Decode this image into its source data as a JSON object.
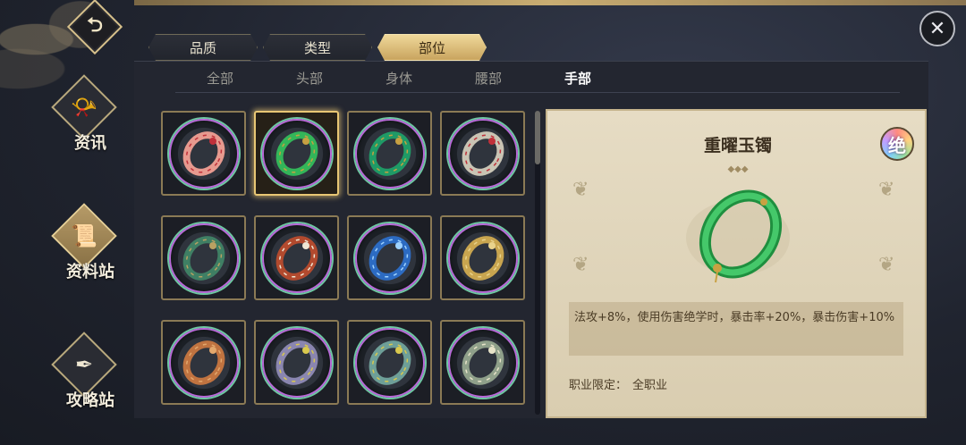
{
  "nav": {
    "back_icon": "back-arrow-icon",
    "close_icon": "close-icon",
    "items": [
      {
        "label": "资讯",
        "icon": "horn-icon",
        "active": false
      },
      {
        "label": "资料站",
        "icon": "scroll-icon",
        "active": true
      },
      {
        "label": "攻略站",
        "icon": "quill-icon",
        "active": false
      }
    ]
  },
  "filter_tabs": [
    {
      "label": "品质",
      "active": false
    },
    {
      "label": "类型",
      "active": false
    },
    {
      "label": "部位",
      "active": true
    }
  ],
  "slot_tabs": [
    {
      "label": "全部",
      "active": false
    },
    {
      "label": "头部",
      "active": false
    },
    {
      "label": "身体",
      "active": false
    },
    {
      "label": "腰部",
      "active": false
    },
    {
      "label": "手部",
      "active": true
    }
  ],
  "items": [
    {
      "icon": "pink-bracelet-icon",
      "color": "#e79a8f",
      "accent": "#c0303a",
      "selected": false
    },
    {
      "icon": "jade-bracelet-icon",
      "color": "#33b559",
      "accent": "#c7a142",
      "selected": true
    },
    {
      "icon": "jade-gem-ring-icon",
      "color": "#1f9a66",
      "accent": "#c7a142",
      "selected": false
    },
    {
      "icon": "silver-ruby-ring-icon",
      "color": "#c9c4b4",
      "accent": "#c0303a",
      "selected": false
    },
    {
      "icon": "green-band-ring-icon",
      "color": "#3f7f64",
      "accent": "#b9a162",
      "selected": false
    },
    {
      "icon": "pearl-bracelet-icon",
      "color": "#b24a2e",
      "accent": "#efe7d4",
      "selected": false
    },
    {
      "icon": "blue-ring-icon",
      "color": "#2c6bc2",
      "accent": "#9fd3ff",
      "selected": false
    },
    {
      "icon": "gold-double-ring-icon",
      "color": "#c8a54f",
      "accent": "#e9d38c",
      "selected": false
    },
    {
      "icon": "copper-double-ring-icon",
      "color": "#c07340",
      "accent": "#e3a86d",
      "selected": false
    },
    {
      "icon": "lavender-scale-ring-icon",
      "color": "#8a86b0",
      "accent": "#d9c94e",
      "selected": false
    },
    {
      "icon": "teal-scale-ring-icon",
      "color": "#6e9f98",
      "accent": "#d9c94e",
      "selected": false
    },
    {
      "icon": "sage-scale-ring-icon",
      "color": "#8fa08a",
      "accent": "#e8e4c9",
      "selected": false
    }
  ],
  "detail": {
    "name": "重曜玉镯",
    "tier_badge": "绝",
    "icon": "jade-bracelet-icon",
    "description": "法攻+8%，使用伤害绝学时，暴击率+20%，暴击伤害+10%",
    "class_label": "职业限定：",
    "class_value": "全职业"
  }
}
